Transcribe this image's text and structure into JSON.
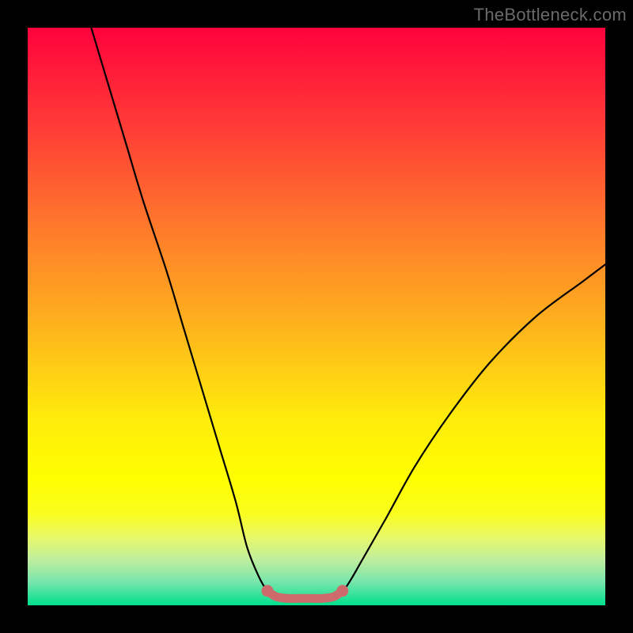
{
  "watermark": {
    "text": "TheBottleneck.com"
  },
  "colors": {
    "frame": "#000000",
    "curve": "#000000",
    "highlight": "#cd6a6c",
    "gradient_stops": [
      {
        "offset": 0.0,
        "color": "#ff023c"
      },
      {
        "offset": 0.18,
        "color": "#ff3f36"
      },
      {
        "offset": 0.36,
        "color": "#ff7e2a"
      },
      {
        "offset": 0.52,
        "color": "#feb41c"
      },
      {
        "offset": 0.67,
        "color": "#feea0b"
      },
      {
        "offset": 0.78,
        "color": "#ffff00"
      },
      {
        "offset": 0.84,
        "color": "#fafd1c"
      },
      {
        "offset": 0.88,
        "color": "#eaf966"
      },
      {
        "offset": 0.92,
        "color": "#c1ee9d"
      },
      {
        "offset": 0.96,
        "color": "#76e5ac"
      },
      {
        "offset": 1.0,
        "color": "#00e08c"
      }
    ]
  },
  "chart_data": {
    "type": "line",
    "title": "",
    "xlabel": "",
    "ylabel": "",
    "xlim": [
      0,
      100
    ],
    "ylim": [
      0,
      100
    ],
    "grid": false,
    "legend_position": "none",
    "series": [
      {
        "name": "left-branch",
        "x": [
          11,
          14,
          17,
          20,
          24,
          27,
          30,
          33,
          36,
          38,
          40,
          41.5,
          43
        ],
        "y": [
          100,
          90,
          80,
          70,
          58,
          48,
          38,
          28,
          18,
          10,
          5,
          2.5,
          1.5
        ]
      },
      {
        "name": "right-branch",
        "x": [
          53,
          55,
          58,
          62,
          67,
          73,
          80,
          88,
          96,
          100
        ],
        "y": [
          1.5,
          3,
          8,
          15,
          24,
          33,
          42,
          50,
          56,
          59
        ]
      },
      {
        "name": "valley-highlight",
        "x": [
          41.5,
          43,
          45,
          47,
          49,
          51,
          53,
          54.5
        ],
        "y": [
          2.5,
          1.5,
          1.2,
          1.2,
          1.2,
          1.2,
          1.5,
          2.5
        ]
      }
    ],
    "annotations": []
  }
}
